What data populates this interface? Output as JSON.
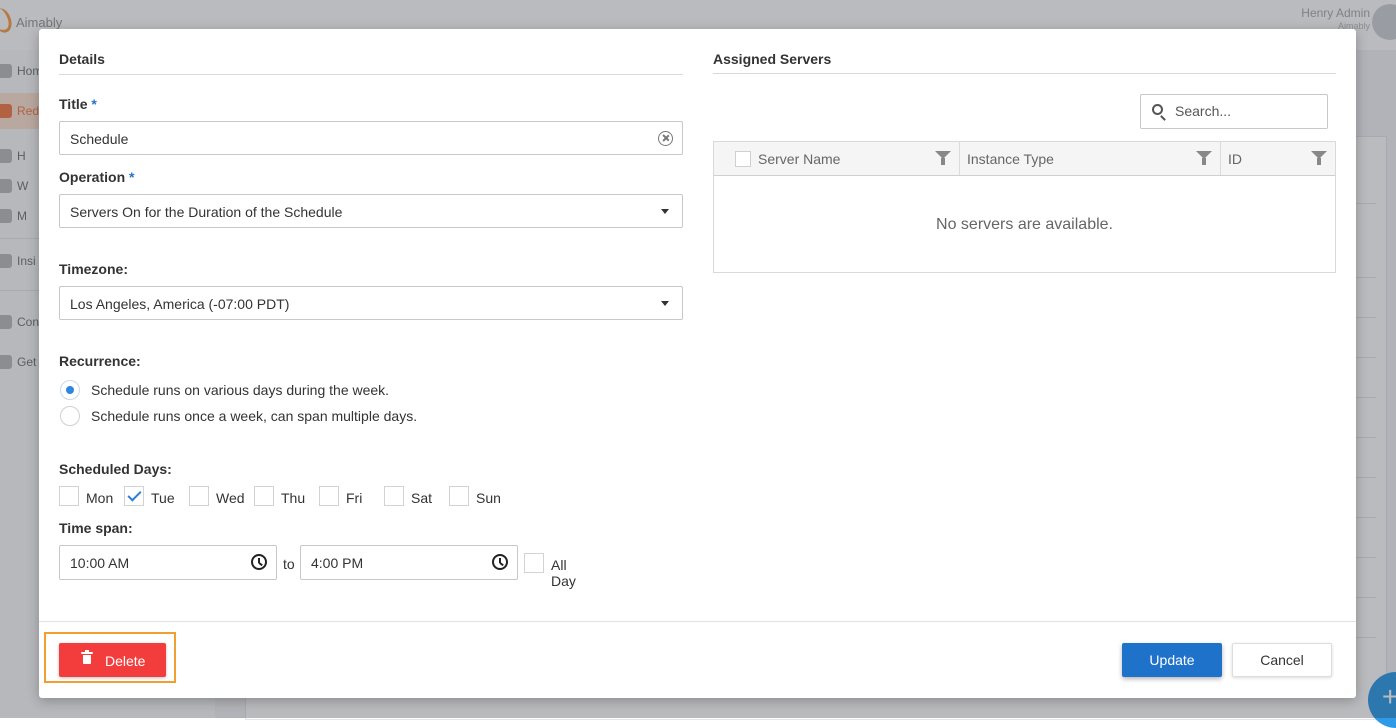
{
  "app": {
    "logo_text": "Aimably",
    "user_name": "Henry Admin",
    "user_org": "Aimably",
    "sidebar": [
      {
        "label": "Hom",
        "icon": "home-icon"
      },
      {
        "label": "Red",
        "icon": "reduce-icon",
        "active": true
      },
      {
        "label": "H",
        "icon": "chart-icon"
      },
      {
        "label": "W",
        "icon": "clock-icon"
      },
      {
        "label": "M",
        "icon": "laptop-icon"
      },
      {
        "label": "Insi",
        "icon": "insights-icon"
      },
      {
        "label": "Con",
        "icon": "config-icon"
      },
      {
        "label": "Get",
        "icon": "help-icon"
      }
    ]
  },
  "modal": {
    "details_title": "Details",
    "assigned_title": "Assigned Servers",
    "title_label": "Title",
    "required_mark": "*",
    "title_value": "Schedule",
    "operation_label": "Operation",
    "operation_value": "Servers On for the Duration of the Schedule",
    "timezone_label": "Timezone:",
    "timezone_value": "Los Angeles, America (-07:00 PDT)",
    "recurrence_label": "Recurrence:",
    "recurrence_options": [
      {
        "label": "Schedule runs on various days during the week.",
        "selected": true
      },
      {
        "label": "Schedule runs once a week, can span multiple days.",
        "selected": false
      }
    ],
    "days_label": "Scheduled Days:",
    "days": [
      {
        "label": "Mon",
        "checked": false
      },
      {
        "label": "Tue",
        "checked": true
      },
      {
        "label": "Wed",
        "checked": false
      },
      {
        "label": "Thu",
        "checked": false
      },
      {
        "label": "Fri",
        "checked": false
      },
      {
        "label": "Sat",
        "checked": false
      },
      {
        "label": "Sun",
        "checked": false
      }
    ],
    "timespan_label": "Time span:",
    "start_time": "10:00 AM",
    "to_text": "to",
    "end_time": "4:00 PM",
    "all_day_label": "All Day",
    "search_placeholder": "Search...",
    "columns": [
      "Server Name",
      "Instance Type",
      "ID"
    ],
    "empty_message": "No servers are available.",
    "delete_label": "Delete",
    "update_label": "Update",
    "cancel_label": "Cancel"
  },
  "colors": {
    "primary": "#1f72c9",
    "danger": "#f33d3d",
    "focus": "#f0a030",
    "accent": "#f27c4a"
  }
}
